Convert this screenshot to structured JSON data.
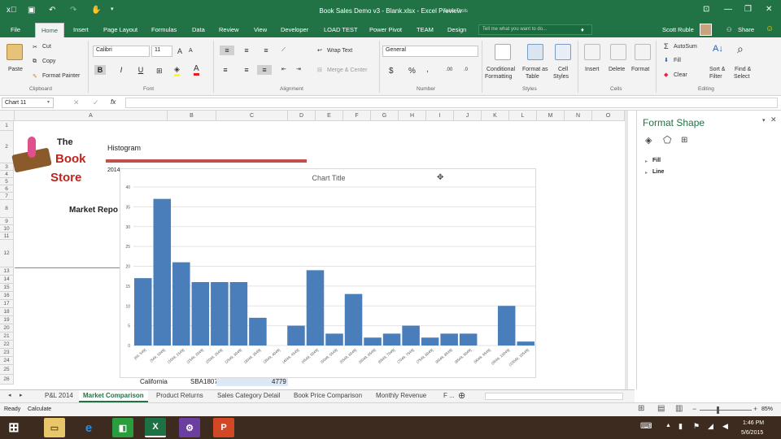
{
  "window": {
    "title": "Book Sales Demo v3 - Blank.xlsx - Excel Preview",
    "context_label": "Table Tools"
  },
  "ribbon_tabs": [
    "File",
    "Home",
    "Insert",
    "Page Layout",
    "Formulas",
    "Data",
    "Review",
    "View",
    "Developer",
    "LOAD TEST",
    "Power Pivot",
    "TEAM",
    "Design"
  ],
  "tell_me_placeholder": "Tell me what you want to do...",
  "user": "Scott Ruble",
  "share_label": "Share",
  "clipboard": {
    "paste": "Paste",
    "cut": "Cut",
    "copy": "Copy",
    "format_painter": "Format Painter",
    "group": "Clipboard"
  },
  "font": {
    "name": "Calibri",
    "size": "11",
    "group": "Font",
    "bold": "B",
    "italic": "I",
    "underline": "U"
  },
  "alignment": {
    "wrap": "Wrap Text",
    "merge": "Merge & Center",
    "group": "Alignment"
  },
  "number": {
    "format": "General",
    "currency": "$",
    "percent": "%",
    "comma": ",",
    "group": "Number"
  },
  "styles": {
    "conditional": "Conditional",
    "conditional2": "Formatting",
    "format_as": "Format as",
    "format_as2": "Table",
    "cell": "Cell",
    "cell2": "Styles",
    "group": "Styles"
  },
  "cells": {
    "insert": "Insert",
    "delete": "Delete",
    "format": "Format",
    "group": "Cells"
  },
  "editing": {
    "autosum": "AutoSum",
    "fill": "Fill",
    "clear": "Clear",
    "sort": "Sort &",
    "sort2": "Filter",
    "find": "Find &",
    "find2": "Select",
    "group": "Editing"
  },
  "namebox": "Chart 11",
  "fx": "fx",
  "columns": [
    "A",
    "B",
    "C",
    "D",
    "E",
    "F",
    "G",
    "H",
    "I",
    "J",
    "K",
    "L",
    "M",
    "N",
    "O"
  ],
  "rows": [
    "1",
    "2",
    "3",
    "4",
    "5",
    "6",
    "7",
    "8",
    "9",
    "10",
    "11",
    "12",
    "13",
    "14",
    "15",
    "16",
    "17",
    "18",
    "19",
    "20",
    "21",
    "22",
    "23",
    "24",
    "25",
    "26"
  ],
  "sheet": {
    "logo_the": "The",
    "logo_book": "Book",
    "logo_store": "Store",
    "histogram_label": "Histogram",
    "year_partial": "2014",
    "market_report_partial": "Market Repo",
    "row26_a": "California",
    "row26_b": "SBA1807",
    "row26_c": "4779"
  },
  "format_pane": {
    "title": "Format Shape",
    "fill": "Fill",
    "line": "Line"
  },
  "sheet_tabs": [
    "P&L 2014",
    "Market Comparison",
    "Product Returns",
    "Sales Category Detail",
    "Book Price Comparison",
    "Monthly Revenue",
    "F ..."
  ],
  "active_sheet_index": 1,
  "status": {
    "ready": "Ready",
    "calculate": "Calculate",
    "zoom": "85%"
  },
  "taskbar": {
    "time": "1:46 PM",
    "date": "5/6/2015"
  },
  "colors": {
    "excel_green": "#217346",
    "bar_fill": "#4a7ebb",
    "histogram_bar": "#c0504d"
  },
  "chart_data": {
    "type": "bar",
    "title": "Chart Title",
    "categories": [
      "[49, 549]",
      "(549, 1049]",
      "(1049, 1549]",
      "(1549, 2049]",
      "(2049, 2549]",
      "(2549, 3049]",
      "(3049, 3549]",
      "(3549, 4049]",
      "(4049, 4549]",
      "(4549, 5049]",
      "(5049, 5549]",
      "(5549, 6049]",
      "(6049, 6549]",
      "(6549, 7049]",
      "(7049, 7549]",
      "(7549, 8049]",
      "(8049, 8549]",
      "(8549, 9049]",
      "(9049, 9549]",
      "(9549, 10049]",
      "(10049, 10549]"
    ],
    "values": [
      17,
      37,
      21,
      16,
      16,
      16,
      7,
      0,
      5,
      19,
      3,
      13,
      2,
      3,
      5,
      2,
      3,
      3,
      0,
      10,
      1
    ],
    "ylim": [
      0,
      40
    ],
    "yticks": [
      "0",
      "5",
      "10",
      "15",
      "20",
      "25",
      "30",
      "35",
      "40"
    ],
    "grid": true
  }
}
